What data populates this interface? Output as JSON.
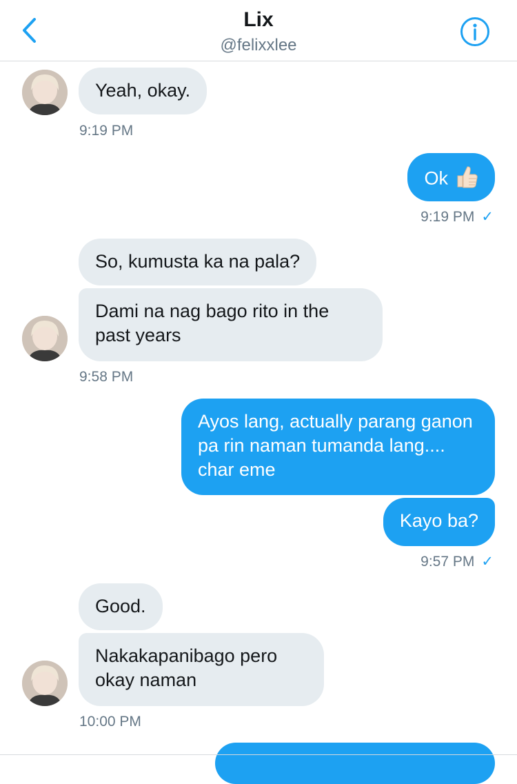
{
  "header": {
    "name": "Lix",
    "handle": "@felixxlee"
  },
  "icons": {
    "back": "chevron-left-icon",
    "info": "info-circle-icon",
    "thumbs_up": "thumbs-up-emoji"
  },
  "colors": {
    "accent": "#1da1f2",
    "incoming_bubble": "#e6ecf0",
    "timestamp": "#657786"
  },
  "messages": [
    {
      "from": "them",
      "text": "Yeah, okay."
    },
    {
      "from": "them",
      "time": "9:19 PM"
    },
    {
      "from": "me",
      "text": "Ok"
    },
    {
      "from": "me",
      "time": "9:19 PM",
      "status": "✓"
    },
    {
      "from": "them",
      "text": "So, kumusta ka na pala?"
    },
    {
      "from": "them",
      "text": "Dami na nag bago rito in the past years"
    },
    {
      "from": "them",
      "time": "9:58 PM"
    },
    {
      "from": "me",
      "text": "Ayos lang, actually parang ganon pa rin naman tumanda lang.... char eme"
    },
    {
      "from": "me",
      "text": "Kayo ba?"
    },
    {
      "from": "me",
      "time": "9:57 PM",
      "status": "✓"
    },
    {
      "from": "them",
      "text": "Good."
    },
    {
      "from": "them",
      "text": "Nakakapanibago pero okay naman"
    },
    {
      "from": "them",
      "time": "10:00 PM"
    }
  ]
}
